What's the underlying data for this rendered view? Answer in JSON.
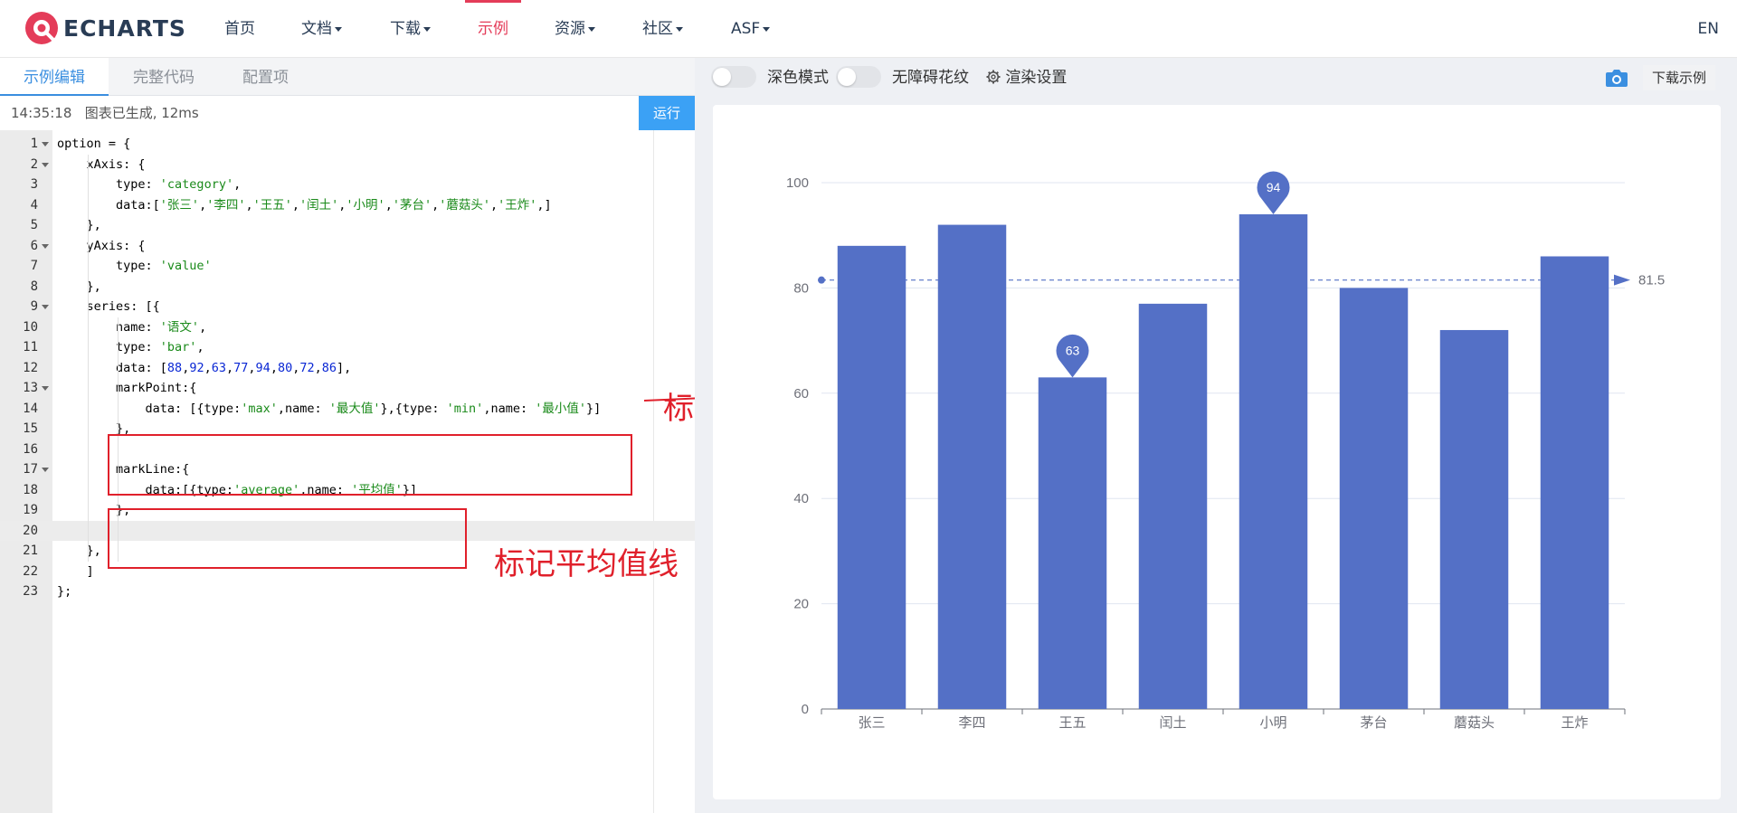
{
  "navbar": {
    "logo_text": "ECHARTS",
    "items": [
      {
        "label": "首页",
        "dropdown": false
      },
      {
        "label": "文档",
        "dropdown": true
      },
      {
        "label": "下载",
        "dropdown": true
      },
      {
        "label": "示例",
        "dropdown": false,
        "active": true
      },
      {
        "label": "资源",
        "dropdown": true
      },
      {
        "label": "社区",
        "dropdown": true
      },
      {
        "label": "ASF",
        "dropdown": true
      }
    ],
    "lang": "EN",
    "accent_color": "#e43c59"
  },
  "editor_panel": {
    "tabs": [
      "示例编辑",
      "完整代码",
      "配置项"
    ],
    "active_tab": "示例编辑",
    "status_time": "14:35:18",
    "status_message": "图表已生成, 12ms",
    "run_label": "运行",
    "code_lines": [
      "option = {",
      "    xAxis: {",
      "        type: 'category',",
      "        data:['张三','李四','王五','闰土','小明','茅台','蘑菇头','王炸',]",
      "    },",
      "    yAxis: {",
      "        type: 'value'",
      "    },",
      "    series: [{",
      "        name: '语文',",
      "        type: 'bar',",
      "        data: [88,92,63,77,94,80,72,86],",
      "        markPoint:{",
      "            data: [{type:'max',name: '最大值'},{type: 'min',name: '最小值'}]",
      "        },",
      "",
      "        markLine:{",
      "            data:[{type:'average',name: '平均值'}]",
      "        },",
      "",
      "    },",
      "    ]",
      "};"
    ],
    "active_line": 20,
    "annotations": {
      "markpoint_label": "标记最值",
      "markline_label": "标记平均值线"
    }
  },
  "preview_panel": {
    "dark_mode_label": "深色模式",
    "aria_label": "无障碍花纹",
    "render_settings_label": "渲染设置",
    "download_label": "下载示例",
    "icons": [
      "gear-icon",
      "camera-icon"
    ]
  },
  "chart_data": {
    "type": "bar",
    "categories": [
      "张三",
      "李四",
      "王五",
      "闰土",
      "小明",
      "茅台",
      "蘑菇头",
      "王炸"
    ],
    "series": [
      {
        "values": [
          88,
          92,
          63,
          77,
          94,
          80,
          72,
          86
        ]
      }
    ],
    "ylim": [
      0,
      100
    ],
    "yticks": [
      0,
      20,
      40,
      60,
      80,
      100
    ],
    "mark_points": [
      {
        "category": "小明",
        "value": 94
      },
      {
        "category": "王五",
        "value": 63
      }
    ],
    "mark_line": {
      "value": 81.5,
      "label": "81.5"
    },
    "bar_color": "#5470c6",
    "grid": true
  }
}
